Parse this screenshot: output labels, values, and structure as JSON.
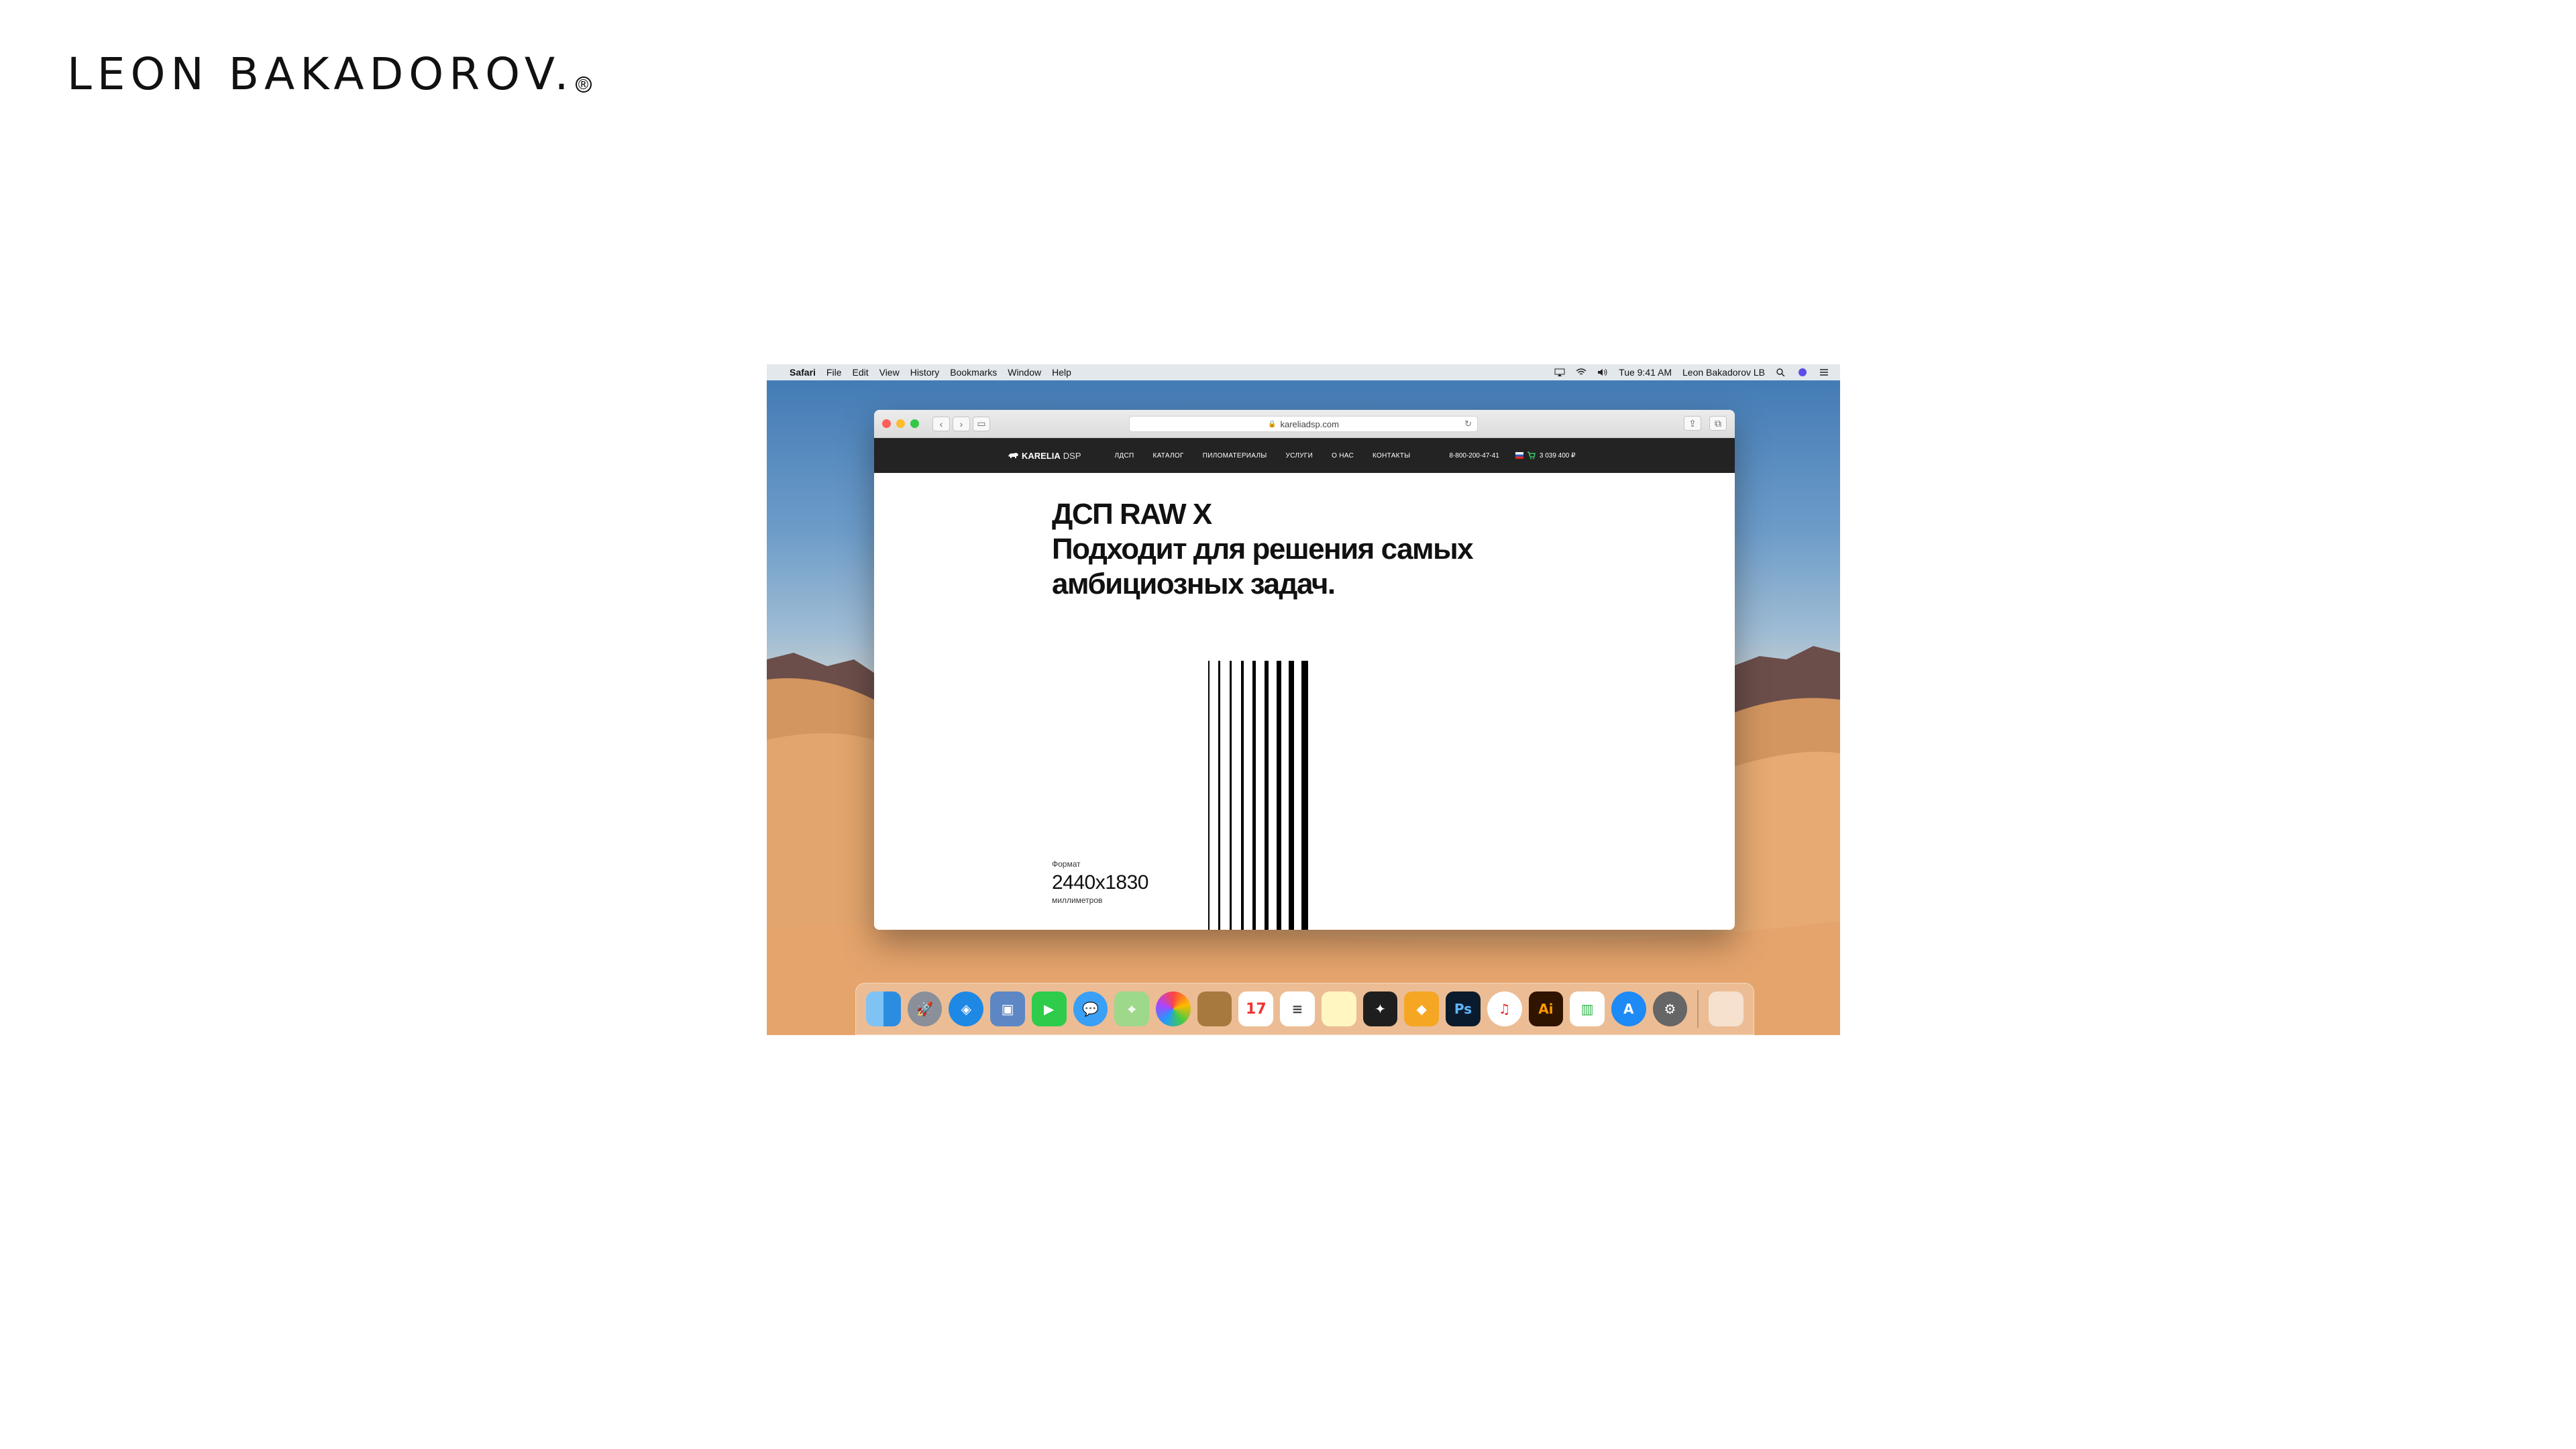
{
  "brand": {
    "name": "LEON BAKADOROV.",
    "mark": "®"
  },
  "menubar": {
    "apple_icon": "apple-icon",
    "items": [
      "Safari",
      "File",
      "Edit",
      "View",
      "History",
      "Bookmarks",
      "Window",
      "Help"
    ],
    "time": "Tue 9:41 AM",
    "user": "Leon Bakadorov LB"
  },
  "browser": {
    "url": "kareliadsp.com"
  },
  "site": {
    "logo_main": "KARELIA",
    "logo_sub": "DSP",
    "nav": [
      "ЛДСП",
      "КАТАЛОГ",
      "ПИЛОМАТЕРИАЛЫ",
      "УСЛУГИ",
      "О НАС",
      "КОНТАКТЫ"
    ],
    "phone": "8-800-200-47-41",
    "cart_total": "3 039 400 ₽"
  },
  "hero": {
    "line1": "ДСП RAW X",
    "line2": "Подходит для решения самых",
    "line3": "амбициозных задач.",
    "format_label": "Формат",
    "format_value": "2440x1830",
    "format_unit": "миллиметров"
  },
  "dock": {
    "apps": [
      "Finder",
      "Launchpad",
      "Safari",
      "Preview",
      "FaceTime",
      "Messages",
      "Maps",
      "Photos",
      "Notes",
      "Calendar",
      "Reminders",
      "Stickies",
      "Figma",
      "Sketch",
      "Photoshop",
      "iTunes",
      "Illustrator",
      "Numbers",
      "App Store",
      "System Preferences",
      "Trash"
    ],
    "calendar_day": "17",
    "ps_label": "Ps",
    "ai_label": "Ai"
  }
}
